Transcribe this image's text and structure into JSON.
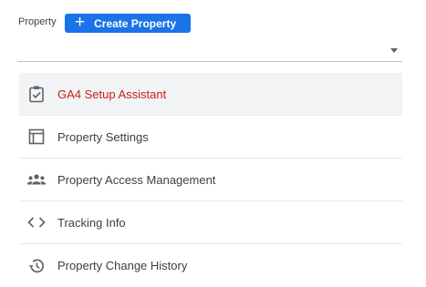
{
  "header": {
    "property_label": "Property",
    "create_button_label": "Create Property",
    "create_button_icon": "plus-icon"
  },
  "selector": {
    "value": "",
    "icon": "dropdown-caret-icon"
  },
  "menu": {
    "items": [
      {
        "label": "GA4 Setup Assistant",
        "icon": "clipboard-check-icon",
        "active": true
      },
      {
        "label": "Property Settings",
        "icon": "layout-icon",
        "active": false
      },
      {
        "label": "Property Access Management",
        "icon": "people-group-icon",
        "active": false
      },
      {
        "label": "Tracking Info",
        "icon": "code-brackets-icon",
        "active": false
      },
      {
        "label": "Property Change History",
        "icon": "history-icon",
        "active": false
      }
    ]
  },
  "colors": {
    "primary": "#1a73e8",
    "active_text": "#c5221f",
    "active_background": "#f1f3f4",
    "icon": "#5f6368"
  }
}
